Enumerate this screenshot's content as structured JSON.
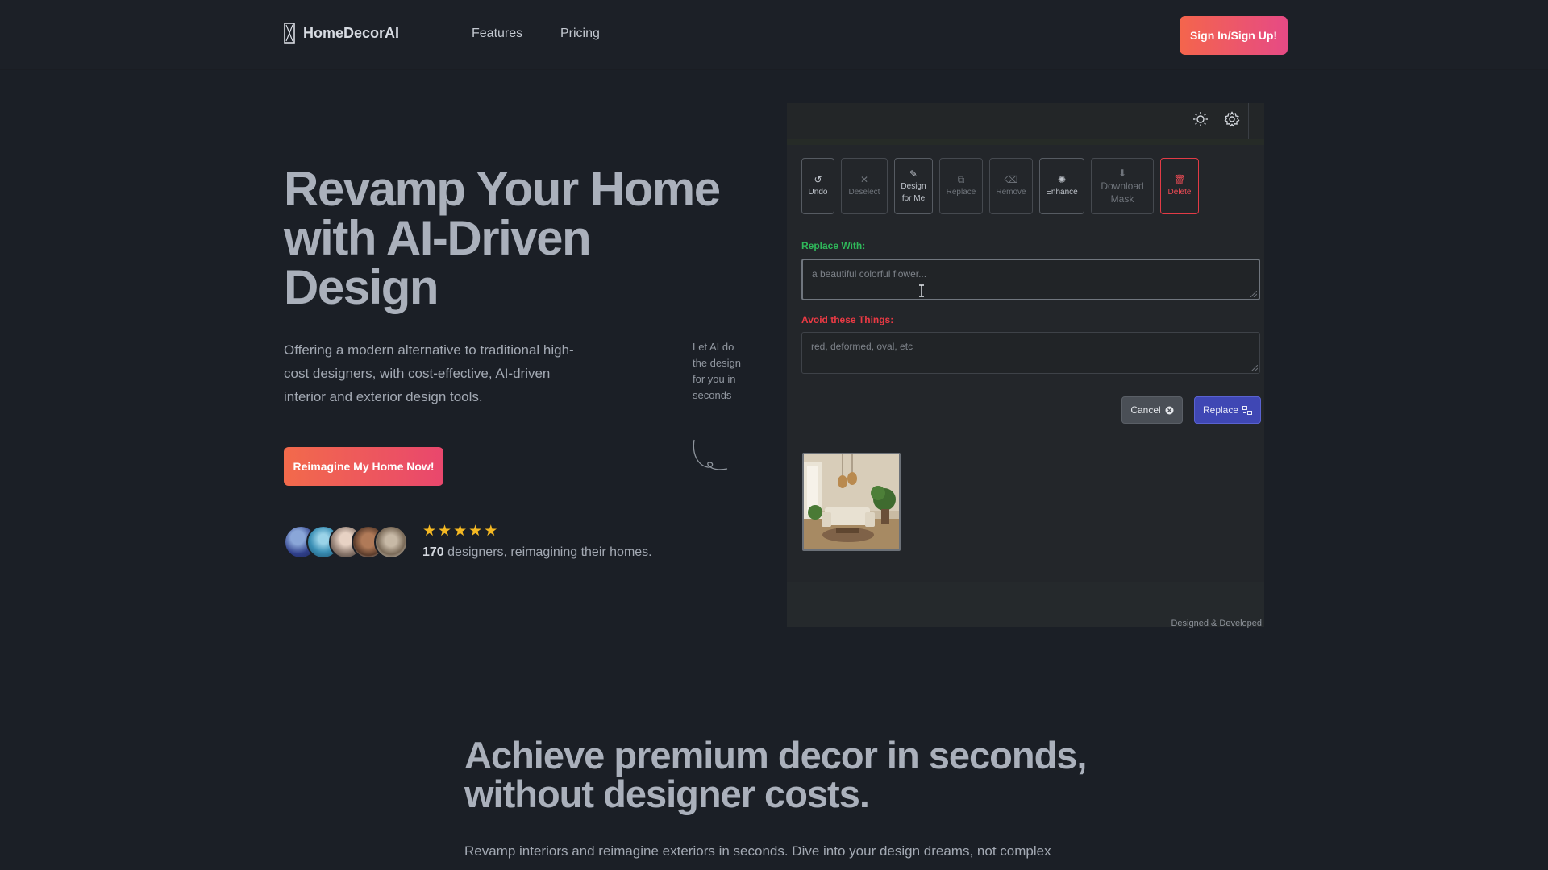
{
  "nav": {
    "brand": "HomeDecorAI",
    "links": [
      "Features",
      "Pricing"
    ],
    "signin_label": "Sign In/Sign Up!"
  },
  "hero": {
    "title": "Revamp Your Home with AI-Driven Design",
    "subtitle": "Offering a modern alternative to traditional high-cost designers, with cost-effective, AI-driven interior and exterior design tools.",
    "cta_label": "Reimagine My Home Now!",
    "rating_stars": 5,
    "designer_count": "170",
    "designers_text": "designers, reimagining their homes.",
    "hint_text": "Let AI do the design for you in seconds"
  },
  "editor": {
    "tools": [
      {
        "label": "Undo",
        "icon": "undo-icon",
        "enabled": true
      },
      {
        "label": "Deselect",
        "icon": "deselect-icon",
        "enabled": false
      },
      {
        "label": "Design for Me",
        "icon": "magic-wand-icon",
        "enabled": true
      },
      {
        "label": "Replace",
        "icon": "replace-icon",
        "enabled": false
      },
      {
        "label": "Remove",
        "icon": "eraser-icon",
        "enabled": false
      },
      {
        "label": "Enhance",
        "icon": "enhance-icon",
        "enabled": true
      },
      {
        "label": "Download Mask",
        "icon": "download-icon",
        "enabled": false
      },
      {
        "label": "Delete",
        "icon": "trash-icon",
        "enabled": true
      }
    ],
    "replace_with_label": "Replace With:",
    "replace_with_placeholder": "a beautiful colorful flower...",
    "avoid_label": "Avoid these Things:",
    "avoid_placeholder": "red, deformed, oval, etc",
    "cancel_label": "Cancel",
    "replace_label": "Replace",
    "footer_text": "Designed & Developed"
  },
  "section2": {
    "title": "Achieve premium decor in seconds, without designer costs.",
    "body": "Revamp interiors and reimagine exteriors in seconds. Dive into your design dreams, not complex interfaces. HomeDecorAI is your pathway to AI-enhanced spaces: EFFORTLESSLY."
  },
  "colors": {
    "background": "#1b1f26",
    "accent_gradient_start": "#f4654c",
    "accent_gradient_end": "#e64a85",
    "star": "#f5b923",
    "replace_button": "#3f47b4",
    "delete": "#ee4b55",
    "label_green": "#2fb85a",
    "label_red": "#ea3a44"
  }
}
